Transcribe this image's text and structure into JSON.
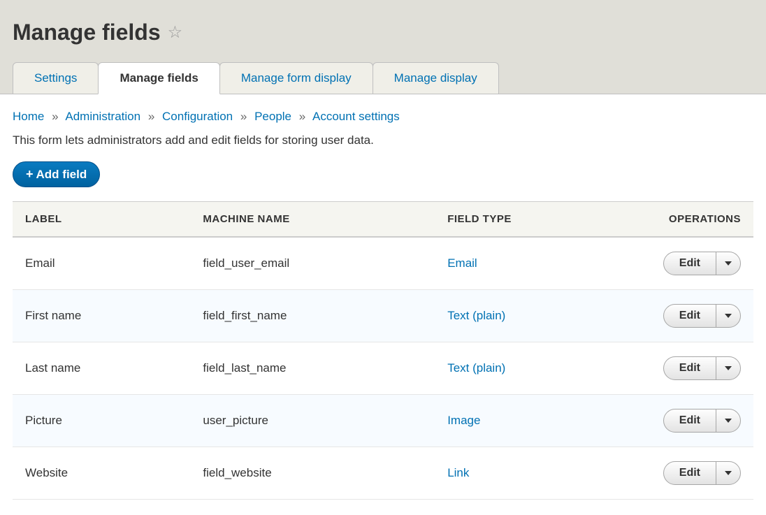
{
  "page": {
    "title": "Manage fields",
    "description": "This form lets administrators add and edit fields for storing user data."
  },
  "tabs": [
    {
      "label": "Settings",
      "active": false
    },
    {
      "label": "Manage fields",
      "active": true
    },
    {
      "label": "Manage form display",
      "active": false
    },
    {
      "label": "Manage display",
      "active": false
    }
  ],
  "breadcrumb": [
    {
      "label": "Home"
    },
    {
      "label": "Administration"
    },
    {
      "label": "Configuration"
    },
    {
      "label": "People"
    },
    {
      "label": "Account settings"
    }
  ],
  "buttons": {
    "add_field": "Add field",
    "edit": "Edit"
  },
  "table": {
    "headers": {
      "label": "LABEL",
      "machine_name": "MACHINE NAME",
      "field_type": "FIELD TYPE",
      "operations": "OPERATIONS"
    },
    "rows": [
      {
        "label": "Email",
        "machine_name": "field_user_email",
        "field_type": "Email"
      },
      {
        "label": "First name",
        "machine_name": "field_first_name",
        "field_type": "Text (plain)"
      },
      {
        "label": "Last name",
        "machine_name": "field_last_name",
        "field_type": "Text (plain)"
      },
      {
        "label": "Picture",
        "machine_name": "user_picture",
        "field_type": "Image"
      },
      {
        "label": "Website",
        "machine_name": "field_website",
        "field_type": "Link"
      }
    ]
  }
}
